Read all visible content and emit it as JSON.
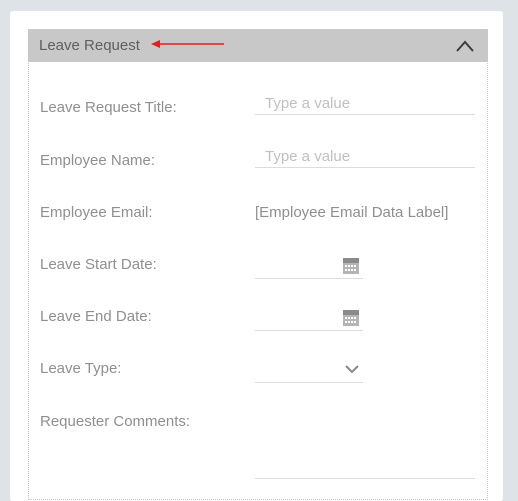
{
  "form": {
    "section_title": "Leave Request",
    "fields": {
      "title": {
        "label": "Leave Request Title:",
        "placeholder": "Type a value",
        "value": ""
      },
      "employee_name": {
        "label": "Employee Name:",
        "placeholder": "Type a value",
        "value": ""
      },
      "employee_email": {
        "label": "Employee Email:",
        "value": "[Employee Email Data Label]"
      },
      "start_date": {
        "label": "Leave Start Date:",
        "icon": "calendar-icon"
      },
      "end_date": {
        "label": "Leave End Date:",
        "icon": "calendar-icon"
      },
      "leave_type": {
        "label": "Leave Type:",
        "icon": "chevron-down-icon"
      },
      "comments": {
        "label": "Requester Comments:"
      }
    }
  },
  "colors": {
    "background": "#dde3e7",
    "header": "#c8c8c8",
    "annotation_arrow": "#e02020"
  }
}
